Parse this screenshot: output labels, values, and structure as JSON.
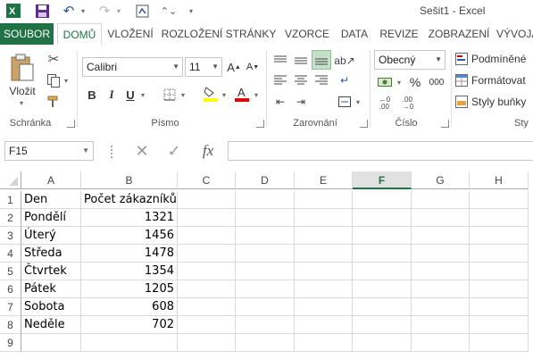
{
  "window": {
    "title": "Sešit1 - Excel"
  },
  "tabs": [
    {
      "label": "SOUBOR"
    },
    {
      "label": "DOMŮ"
    },
    {
      "label": "VLOŽENÍ"
    },
    {
      "label": "ROZLOŽENÍ STRÁNKY"
    },
    {
      "label": "VZORCE"
    },
    {
      "label": "DATA"
    },
    {
      "label": "REVIZE"
    },
    {
      "label": "ZOBRAZENÍ"
    },
    {
      "label": "VÝVOJÁ"
    }
  ],
  "ribbon": {
    "clipboard": {
      "paste_label": "Vložit",
      "group_label": "Schránka"
    },
    "font": {
      "font_name": "Calibri",
      "font_size": "11",
      "bold": "B",
      "italic": "I",
      "underline": "U",
      "group_label": "Písmo"
    },
    "alignment": {
      "group_label": "Zarovnání"
    },
    "number": {
      "format": "Obecný",
      "percent": "%",
      "thousands": "000",
      "group_label": "Číslo"
    },
    "styles": {
      "conditional": "Podmíněné",
      "format_table": "Formátovat",
      "cell_styles": "Styly buňky",
      "group_label": "Sty"
    }
  },
  "formula_bar": {
    "name_box": "F15",
    "fx": "fx",
    "formula": ""
  },
  "sheet": {
    "columns": [
      "A",
      "B",
      "C",
      "D",
      "E",
      "F",
      "G",
      "H"
    ],
    "selected_column": "F",
    "rows": [
      "1",
      "2",
      "3",
      "4",
      "5",
      "6",
      "7",
      "8",
      "9"
    ],
    "cells": [
      [
        "Den",
        "Počet zákazníků"
      ],
      [
        "Pondělí",
        "1321"
      ],
      [
        "Úterý",
        "1456"
      ],
      [
        "Středa",
        "1478"
      ],
      [
        "Čtvrtek",
        "1354"
      ],
      [
        "Pátek",
        "1205"
      ],
      [
        "Sobota",
        "608"
      ],
      [
        "Neděle",
        "702"
      ],
      [
        "",
        ""
      ]
    ]
  },
  "colors": {
    "accent": "#217346"
  }
}
